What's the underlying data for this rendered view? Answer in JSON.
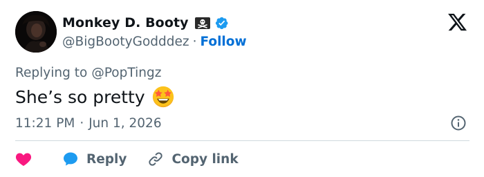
{
  "author": {
    "display_name": "Monkey D. Booty",
    "handle": "@BigBootyGodddez",
    "separator": "·",
    "follow_label": "Follow",
    "badges": [
      "pirate-flag-icon",
      "verified-badge-icon"
    ]
  },
  "reply_context": {
    "prefix": "Replying to",
    "mention": "@PopTingz"
  },
  "tweet": {
    "text": "She’s so pretty",
    "emoji": "star-struck-emoji"
  },
  "meta": {
    "time": "11:21 PM",
    "separator": "·",
    "date": "Jun 1, 2026"
  },
  "actions": {
    "like_icon": "heart-icon",
    "reply_label": "Reply",
    "copy_label": "Copy link"
  },
  "colors": {
    "text_primary": "#0f1419",
    "text_secondary": "#536471",
    "link": "#006fd6",
    "verified": "#1d9bf0",
    "like": "#f91880",
    "divider": "#cfd9de"
  }
}
